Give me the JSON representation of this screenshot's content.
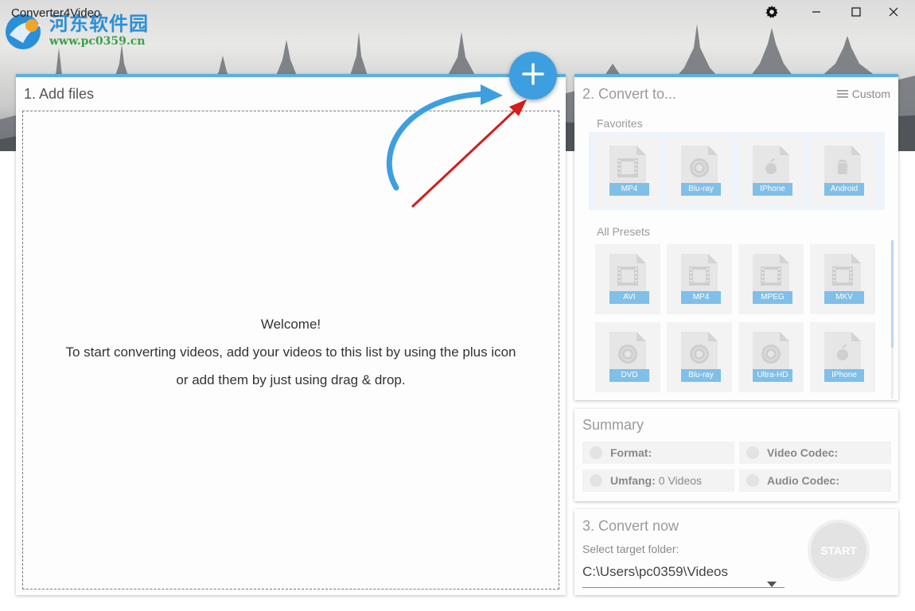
{
  "window": {
    "title": "Converter4Video",
    "icons": [
      "gear-icon",
      "minimize-icon",
      "maximize-icon",
      "close-icon"
    ]
  },
  "watermark": {
    "chinese_text": "河东软件园",
    "url": "www.pc0359.cn"
  },
  "add_files": {
    "title": "1. Add files",
    "welcome_line1": "Welcome!",
    "welcome_line2": "To start converting videos, add your videos to this list by using the plus icon",
    "welcome_line3": "or add them by just using drag & drop."
  },
  "convert_to": {
    "title": "2. Convert to...",
    "custom_label": "Custom",
    "favorites_label": "Favorites",
    "favorites": [
      {
        "label": "MP4",
        "icon": "film-icon"
      },
      {
        "label": "Blu-ray",
        "icon": "disc-icon"
      },
      {
        "label": "IPhone",
        "icon": "apple-icon"
      },
      {
        "label": "Android",
        "icon": "android-icon"
      }
    ],
    "all_presets_label": "All Presets",
    "presets": [
      {
        "label": "AVI",
        "icon": "film-icon"
      },
      {
        "label": "MP4",
        "icon": "film-icon"
      },
      {
        "label": "MPEG",
        "icon": "film-icon"
      },
      {
        "label": "MKV",
        "icon": "film-icon"
      },
      {
        "label": "DVD",
        "icon": "disc-icon"
      },
      {
        "label": "Blu-ray",
        "icon": "disc-icon"
      },
      {
        "label": "Ultra-HD",
        "icon": "disc-icon"
      },
      {
        "label": "IPhone",
        "icon": "apple-icon"
      }
    ]
  },
  "summary": {
    "title": "Summary",
    "format_label": "Format:",
    "video_codec_label": "Video Codec:",
    "umfang_label": "Umfang:",
    "umfang_value": "0 Videos",
    "audio_codec_label": "Audio Codec:"
  },
  "convert_now": {
    "title": "3. Convert now",
    "folder_label": "Select target folder:",
    "folder_value": "C:\\Users\\pc0359\\Videos",
    "start_label": "START"
  },
  "colors": {
    "accent": "#3d9fe0",
    "panel_top": "#5ab0e6",
    "preset_label": "#7fbfe8",
    "wm_blue": "#2b8fd8",
    "wm_green": "#3aa04a",
    "arrow_red": "#d41c1c"
  }
}
